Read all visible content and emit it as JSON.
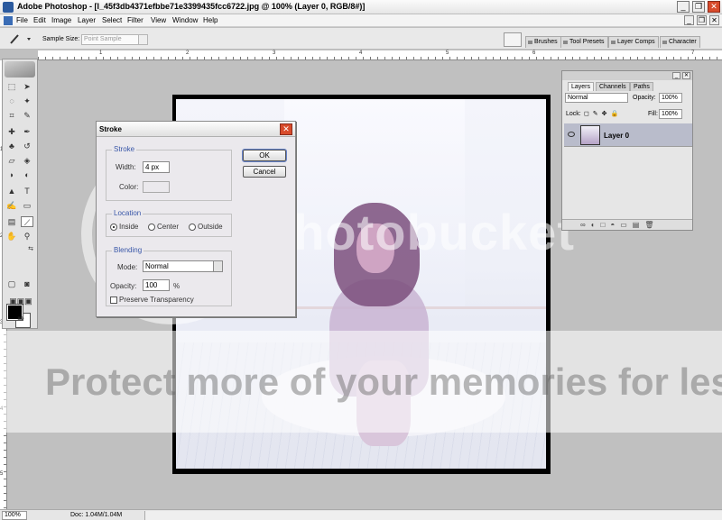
{
  "window": {
    "title": "Adobe Photoshop - [l_45f3db4371efbbe71e3399435fcc6722.jpg @ 100% (Layer 0, RGB/8#)]",
    "minimize": "_",
    "restore": "❐",
    "close": "✕"
  },
  "menu": {
    "items": [
      "File",
      "Edit",
      "Image",
      "Layer",
      "Select",
      "Filter",
      "View",
      "Window",
      "Help"
    ]
  },
  "options": {
    "sample_size_label": "Sample Size:",
    "sample_size_value": "Point Sample",
    "wells": [
      "Brushes",
      "Tool Presets",
      "Layer Comps",
      "Character"
    ]
  },
  "rulers": {
    "h": [
      "1",
      "2",
      "3",
      "4",
      "5",
      "6",
      "7"
    ],
    "v": [
      "1",
      "2",
      "3",
      "4",
      "5"
    ]
  },
  "stroke_dialog": {
    "title": "Stroke",
    "stroke_group": "Stroke",
    "width_label": "Width:",
    "width_value": "4 px",
    "color_label": "Color:",
    "location_group": "Location",
    "inside": "Inside",
    "center": "Center",
    "outside": "Outside",
    "blending_group": "Blending",
    "mode_label": "Mode:",
    "mode_value": "Normal",
    "opacity_label": "Opacity:",
    "opacity_value": "100",
    "opacity_unit": "%",
    "preserve": "Preserve Transparency",
    "ok": "OK",
    "cancel": "Cancel"
  },
  "layers_palette": {
    "tabs": [
      "Layers",
      "Channels",
      "Paths"
    ],
    "blend_mode": "Normal",
    "opacity_label": "Opacity:",
    "opacity_value": "100%",
    "lock_label": "Lock:",
    "fill_label": "Fill:",
    "fill_value": "100%",
    "layer_name": "Layer 0"
  },
  "watermark": {
    "logo": "photobucket",
    "protect": "Protect more of your memories for less!"
  },
  "status": {
    "zoom": "100%",
    "doc": "Doc: 1.04M/1.04M"
  }
}
